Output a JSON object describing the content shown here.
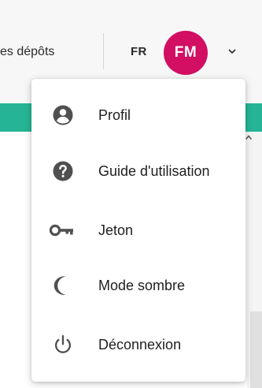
{
  "header": {
    "nav_link": "es dépôts",
    "lang_button": "FR",
    "avatar_initials": "FM",
    "avatar_color": "#d20f62",
    "chevron_icon": "chevron-down-icon"
  },
  "colors": {
    "accent_strip": "#25b596",
    "menu_icon": "#505050"
  },
  "user_menu": {
    "items": [
      {
        "label": "Profil",
        "icon": "account-circle-icon"
      },
      {
        "label": "Guide d'utilisation",
        "icon": "help-circle-icon"
      },
      {
        "label": "Jeton",
        "icon": "key-icon"
      },
      {
        "label": "Mode sombre",
        "icon": "moon-icon"
      },
      {
        "label": "Déconnexion",
        "icon": "power-icon"
      }
    ]
  }
}
